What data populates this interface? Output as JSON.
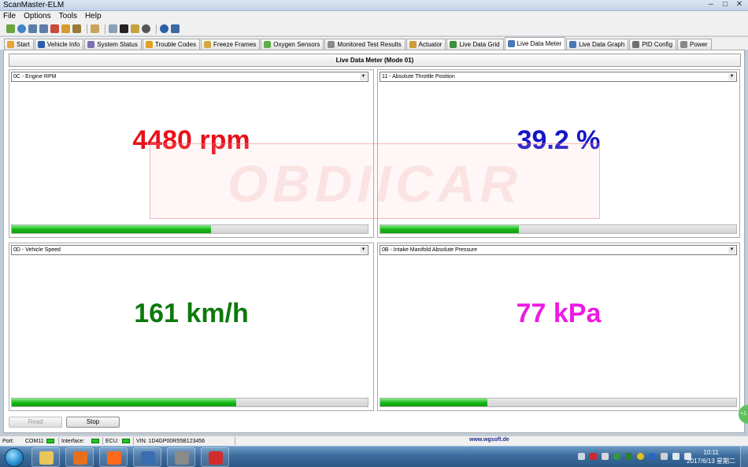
{
  "window": {
    "title": "ScanMaster-ELM"
  },
  "menu": [
    "File",
    "Options",
    "Tools",
    "Help"
  ],
  "tabs": [
    {
      "label": "Start",
      "icon": "start-icon",
      "icon_color": "#e9a435"
    },
    {
      "label": "Vehicle Info",
      "icon": "info-icon",
      "icon_color": "#2d5ea8"
    },
    {
      "label": "System Status",
      "icon": "status-icon",
      "icon_color": "#7d6fb3"
    },
    {
      "label": "Trouble Codes",
      "icon": "warning-icon",
      "icon_color": "#e0a020"
    },
    {
      "label": "Freeze Frames",
      "icon": "freeze-icon",
      "icon_color": "#d4a83d"
    },
    {
      "label": "Oxygen Sensors",
      "icon": "oxygen-icon",
      "icon_color": "#5fae4a"
    },
    {
      "label": "Monitored Test Results",
      "icon": "gear-icon",
      "icon_color": "#8a8a8a"
    },
    {
      "label": "Actuator",
      "icon": "actuator-icon",
      "icon_color": "#d19a3a"
    },
    {
      "label": "Live Data Grid",
      "icon": "grid-icon",
      "icon_color": "#3c8f3c"
    },
    {
      "label": "Live Data Meter",
      "icon": "meter-icon",
      "icon_color": "#4b77b5",
      "active": true
    },
    {
      "label": "Live Data Graph",
      "icon": "graph-icon",
      "icon_color": "#4b77b5"
    },
    {
      "label": "PID Config",
      "icon": "config-icon",
      "icon_color": "#6f6f6f"
    },
    {
      "label": "Power",
      "icon": "power-icon",
      "icon_color": "#888888"
    }
  ],
  "page_title": "Live Data Meter (Mode 01)",
  "meters": [
    {
      "pid": "0C - Engine RPM",
      "value": "4480 rpm",
      "color": "#e8101a",
      "level": 0.56
    },
    {
      "pid": "11 - Absolute Throttle Position",
      "value": "39.2 %",
      "color": "#1414c8",
      "level": 0.39
    },
    {
      "pid": "0D - Vehicle Speed",
      "value": "161 km/h",
      "color": "#0c7a0c",
      "level": 0.63
    },
    {
      "pid": "0B - Intake Manifold Absolute Pressure",
      "value": "77 kPa",
      "color": "#ee1ae3",
      "level": 0.3
    }
  ],
  "watermark": "OBDIICAR",
  "buttons": {
    "read": "Read",
    "stop": "Stop"
  },
  "side_tab": "+1",
  "status": {
    "port_label": "Port:",
    "port_value": "COM11",
    "interface_label": "Interface:",
    "ecu_label": "ECU:",
    "vin": "VIN: 1D4GP00R55B123456",
    "url": "www.wgsoft.de"
  },
  "taskbar": {
    "time": "10:11",
    "date": "2017/6/13 星期二",
    "apps": [
      {
        "name": "explorer-icon",
        "color": "#e8c65a"
      },
      {
        "name": "firefox-icon",
        "color": "#e8701d"
      },
      {
        "name": "taobao-icon",
        "color": "#ff6a1a"
      },
      {
        "name": "obd-app-icon",
        "color": "#3b6db1"
      },
      {
        "name": "chip-icon",
        "color": "#8a8a8a"
      },
      {
        "name": "scanmaster-icon",
        "color": "#d32c2c"
      }
    ]
  }
}
